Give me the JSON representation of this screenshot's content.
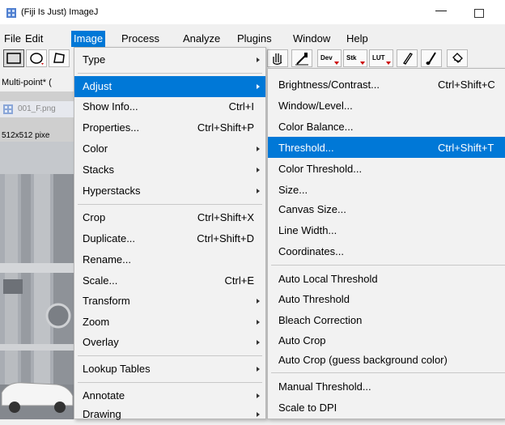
{
  "window": {
    "title": "(Fiji Is Just) ImageJ",
    "minimize_glyph": "—"
  },
  "menubar": [
    "File",
    "Edit",
    "Image",
    "Process",
    "Analyze",
    "Plugins",
    "Window",
    "Help"
  ],
  "toolbar": {
    "buttons": [
      {
        "name": "rectangle-tool",
        "icon": "rectangle-icon"
      },
      {
        "name": "oval-tool",
        "icon": "oval-icon"
      },
      {
        "name": "polygon-tool",
        "icon": "polygon-icon"
      },
      {
        "name": "scroll-tool",
        "icon": "hand-icon"
      },
      {
        "name": "color-picker-tool",
        "icon": "dropper-icon"
      },
      {
        "name": "dev-tool",
        "label": "Dev"
      },
      {
        "name": "stk-tool",
        "label": "Stk"
      },
      {
        "name": "lut-tool",
        "label": "LUT"
      },
      {
        "name": "pencil-tool",
        "icon": "pencil-icon"
      },
      {
        "name": "brush-tool",
        "icon": "brush-icon"
      },
      {
        "name": "flood-fill-tool",
        "icon": "bucket-icon"
      }
    ]
  },
  "status_text": "Multi-point* (",
  "image_window": {
    "title": "001_F.png",
    "info": "512x512 pixe"
  },
  "image_menu": {
    "items": [
      {
        "label": "Type",
        "shortcut": "",
        "submenu": true
      },
      {
        "label": "Adjust",
        "shortcut": "",
        "submenu": true,
        "highlighted": true
      },
      {
        "label": "Show Info...",
        "shortcut": "Ctrl+I",
        "submenu": false
      },
      {
        "label": "Properties...",
        "shortcut": "Ctrl+Shift+P",
        "submenu": false
      },
      {
        "label": "Color",
        "shortcut": "",
        "submenu": true
      },
      {
        "label": "Stacks",
        "shortcut": "",
        "submenu": true
      },
      {
        "label": "Hyperstacks",
        "shortcut": "",
        "submenu": true
      },
      {
        "label": "Crop",
        "shortcut": "Ctrl+Shift+X",
        "submenu": false
      },
      {
        "label": "Duplicate...",
        "shortcut": "Ctrl+Shift+D",
        "submenu": false
      },
      {
        "label": "Rename...",
        "shortcut": "",
        "submenu": false
      },
      {
        "label": "Scale...",
        "shortcut": "Ctrl+E",
        "submenu": false
      },
      {
        "label": "Transform",
        "shortcut": "",
        "submenu": true
      },
      {
        "label": "Zoom",
        "shortcut": "",
        "submenu": true
      },
      {
        "label": "Overlay",
        "shortcut": "",
        "submenu": true
      },
      {
        "label": "Lookup Tables",
        "shortcut": "",
        "submenu": true
      },
      {
        "label": "Annotate",
        "shortcut": "",
        "submenu": true
      },
      {
        "label": "Drawing",
        "shortcut": "",
        "submenu": true
      }
    ]
  },
  "adjust_menu": {
    "items": [
      {
        "label": "Brightness/Contrast...",
        "shortcut": "Ctrl+Shift+C"
      },
      {
        "label": "Window/Level...",
        "shortcut": ""
      },
      {
        "label": "Color Balance...",
        "shortcut": ""
      },
      {
        "label": "Threshold...",
        "shortcut": "Ctrl+Shift+T",
        "highlighted": true
      },
      {
        "label": "Color Threshold...",
        "shortcut": ""
      },
      {
        "label": "Size...",
        "shortcut": ""
      },
      {
        "label": "Canvas Size...",
        "shortcut": ""
      },
      {
        "label": "Line Width...",
        "shortcut": ""
      },
      {
        "label": "Coordinates...",
        "shortcut": ""
      },
      {
        "label": "Auto Local Threshold",
        "shortcut": ""
      },
      {
        "label": "Auto Threshold",
        "shortcut": ""
      },
      {
        "label": "Bleach Correction",
        "shortcut": ""
      },
      {
        "label": "Auto Crop",
        "shortcut": ""
      },
      {
        "label": "Auto Crop (guess background color)",
        "shortcut": ""
      },
      {
        "label": "Manual Threshold...",
        "shortcut": ""
      },
      {
        "label": "Scale to DPI",
        "shortcut": ""
      }
    ]
  },
  "colors": {
    "highlight": "#0078d7",
    "menu_bg": "#f2f2f2",
    "app_icon": "#4f7fd0"
  }
}
